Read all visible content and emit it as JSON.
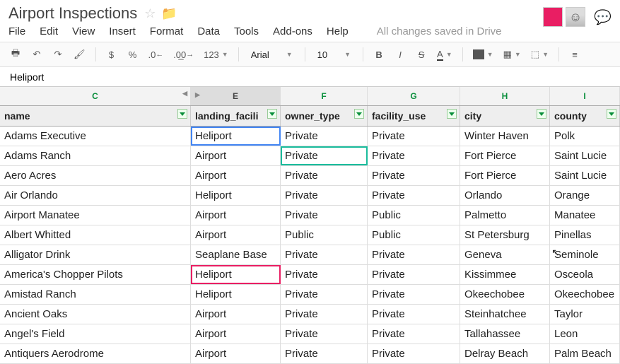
{
  "doc_title": "Airport Inspections",
  "menu": {
    "file": "File",
    "edit": "Edit",
    "view": "View",
    "insert": "Insert",
    "format": "Format",
    "data": "Data",
    "tools": "Tools",
    "addons": "Add-ons",
    "help": "Help",
    "save_state": "All changes saved in Drive"
  },
  "toolbar": {
    "currency": "$",
    "percent": "%",
    "dec_dec": ".0←",
    "inc_dec": ".00→",
    "numfmt": "123",
    "font": "Arial",
    "size": "10",
    "bold": "B",
    "italic": "I",
    "strike": "S",
    "textcolor": "A"
  },
  "formula_value": "Heliport",
  "columns": [
    {
      "letter": "C",
      "header": "name"
    },
    {
      "letter": "E",
      "header": "landing_facili"
    },
    {
      "letter": "F",
      "header": "owner_type"
    },
    {
      "letter": "G",
      "header": "facility_use"
    },
    {
      "letter": "H",
      "header": "city"
    },
    {
      "letter": "I",
      "header": "county"
    }
  ],
  "rows": [
    {
      "c": [
        "Adams Executive",
        "Heliport",
        "Private",
        "Private",
        "Winter Haven",
        "Polk"
      ]
    },
    {
      "c": [
        "Adams Ranch",
        "Airport",
        "Private",
        "Private",
        "Fort Pierce",
        "Saint Lucie"
      ]
    },
    {
      "c": [
        "Aero Acres",
        "Airport",
        "Private",
        "Private",
        "Fort Pierce",
        "Saint Lucie"
      ]
    },
    {
      "c": [
        "Air Orlando",
        "Heliport",
        "Private",
        "Private",
        "Orlando",
        "Orange"
      ]
    },
    {
      "c": [
        "Airport Manatee",
        "Airport",
        "Private",
        "Public",
        "Palmetto",
        "Manatee"
      ]
    },
    {
      "c": [
        "Albert Whitted",
        "Airport",
        "Public",
        "Public",
        "St Petersburg",
        "Pinellas"
      ]
    },
    {
      "c": [
        "Alligator Drink",
        "Seaplane Base",
        "Private",
        "Private",
        "Geneva",
        "Seminole"
      ]
    },
    {
      "c": [
        "America's Chopper Pilots",
        "Heliport",
        "Private",
        "Private",
        "Kissimmee",
        "Osceola"
      ]
    },
    {
      "c": [
        "Amistad Ranch",
        "Heliport",
        "Private",
        "Private",
        "Okeechobee",
        "Okeechobee"
      ]
    },
    {
      "c": [
        "Ancient Oaks",
        "Airport",
        "Private",
        "Private",
        "Steinhatchee",
        "Taylor"
      ]
    },
    {
      "c": [
        "Angel's Field",
        "Airport",
        "Private",
        "Private",
        "Tallahassee",
        "Leon"
      ]
    },
    {
      "c": [
        "Antiquers Aerodrome",
        "Airport",
        "Private",
        "Private",
        "Delray Beach",
        "Palm Beach"
      ]
    }
  ],
  "chart_data": {
    "type": "table",
    "columns": [
      "name",
      "landing_facility_type",
      "owner_type",
      "facility_use",
      "city",
      "county"
    ],
    "rows": [
      [
        "Adams Executive",
        "Heliport",
        "Private",
        "Private",
        "Winter Haven",
        "Polk"
      ],
      [
        "Adams Ranch",
        "Airport",
        "Private",
        "Private",
        "Fort Pierce",
        "Saint Lucie"
      ],
      [
        "Aero Acres",
        "Airport",
        "Private",
        "Private",
        "Fort Pierce",
        "Saint Lucie"
      ],
      [
        "Air Orlando",
        "Heliport",
        "Private",
        "Private",
        "Orlando",
        "Orange"
      ],
      [
        "Airport Manatee",
        "Airport",
        "Private",
        "Public",
        "Palmetto",
        "Manatee"
      ],
      [
        "Albert Whitted",
        "Airport",
        "Public",
        "Public",
        "St Petersburg",
        "Pinellas"
      ],
      [
        "Alligator Drink",
        "Seaplane Base",
        "Private",
        "Private",
        "Geneva",
        "Seminole"
      ],
      [
        "America's Chopper Pilots",
        "Heliport",
        "Private",
        "Private",
        "Kissimmee",
        "Osceola"
      ],
      [
        "Amistad Ranch",
        "Heliport",
        "Private",
        "Private",
        "Okeechobee",
        "Okeechobee"
      ],
      [
        "Ancient Oaks",
        "Airport",
        "Private",
        "Private",
        "Steinhatchee",
        "Taylor"
      ],
      [
        "Angel's Field",
        "Airport",
        "Private",
        "Private",
        "Tallahassee",
        "Leon"
      ],
      [
        "Antiquers Aerodrome",
        "Airport",
        "Private",
        "Private",
        "Delray Beach",
        "Palm Beach"
      ]
    ]
  }
}
